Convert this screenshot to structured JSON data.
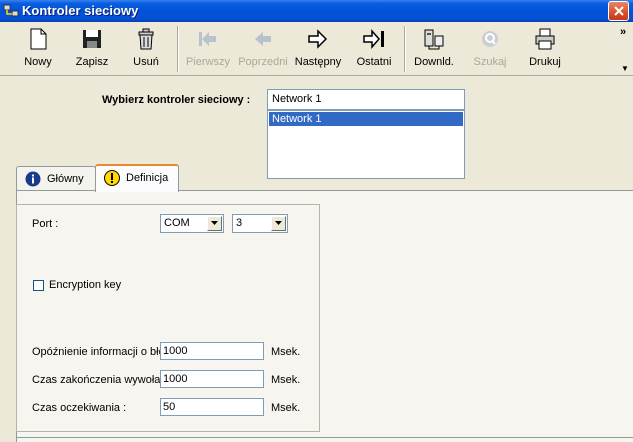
{
  "window": {
    "title": "Kontroler sieciowy"
  },
  "toolbar": {
    "buttons": [
      {
        "label": "Nowy",
        "icon": "new-document-icon",
        "enabled": true
      },
      {
        "label": "Zapisz",
        "icon": "floppy-disk-icon",
        "enabled": true
      },
      {
        "label": "Usuń",
        "icon": "trash-can-icon",
        "enabled": true
      },
      {
        "label": "Pierwszy",
        "icon": "first-record-icon",
        "enabled": false
      },
      {
        "label": "Poprzedni",
        "icon": "previous-record-icon",
        "enabled": false
      },
      {
        "label": "Następny",
        "icon": "next-record-icon",
        "enabled": true
      },
      {
        "label": "Ostatni",
        "icon": "last-record-icon",
        "enabled": true
      },
      {
        "label": "Downld.",
        "icon": "download-icon",
        "enabled": true
      },
      {
        "label": "Szukaj",
        "icon": "search-icon",
        "enabled": false
      },
      {
        "label": "Drukuj",
        "icon": "printer-icon",
        "enabled": true
      }
    ],
    "overflow": "»"
  },
  "selector": {
    "label": "Wybierz kontroler sieciowy :",
    "value": "Network 1",
    "list": [
      "Network 1"
    ]
  },
  "tabs": [
    {
      "label": "Główny",
      "icon": "info-icon",
      "active": false
    },
    {
      "label": "Definicja",
      "icon": "warning-icon",
      "active": true
    }
  ],
  "form": {
    "port_label": "Port :",
    "port_type": "COM",
    "port_number": "3",
    "encryption_label": "Encryption key",
    "encryption_checked": false,
    "fields": [
      {
        "label": "Opóźnienie informacji o błędzie :",
        "value": "1000",
        "unit": "Msek."
      },
      {
        "label": "Czas zakończenia wywołania :",
        "value": "1000",
        "unit": "Msek."
      },
      {
        "label": "Czas oczekiwania :",
        "value": "50",
        "unit": "Msek."
      }
    ]
  },
  "colors": {
    "titlebar": "#0053d8",
    "selection": "#316ac5",
    "active_tab_accent": "#e68b2c"
  }
}
